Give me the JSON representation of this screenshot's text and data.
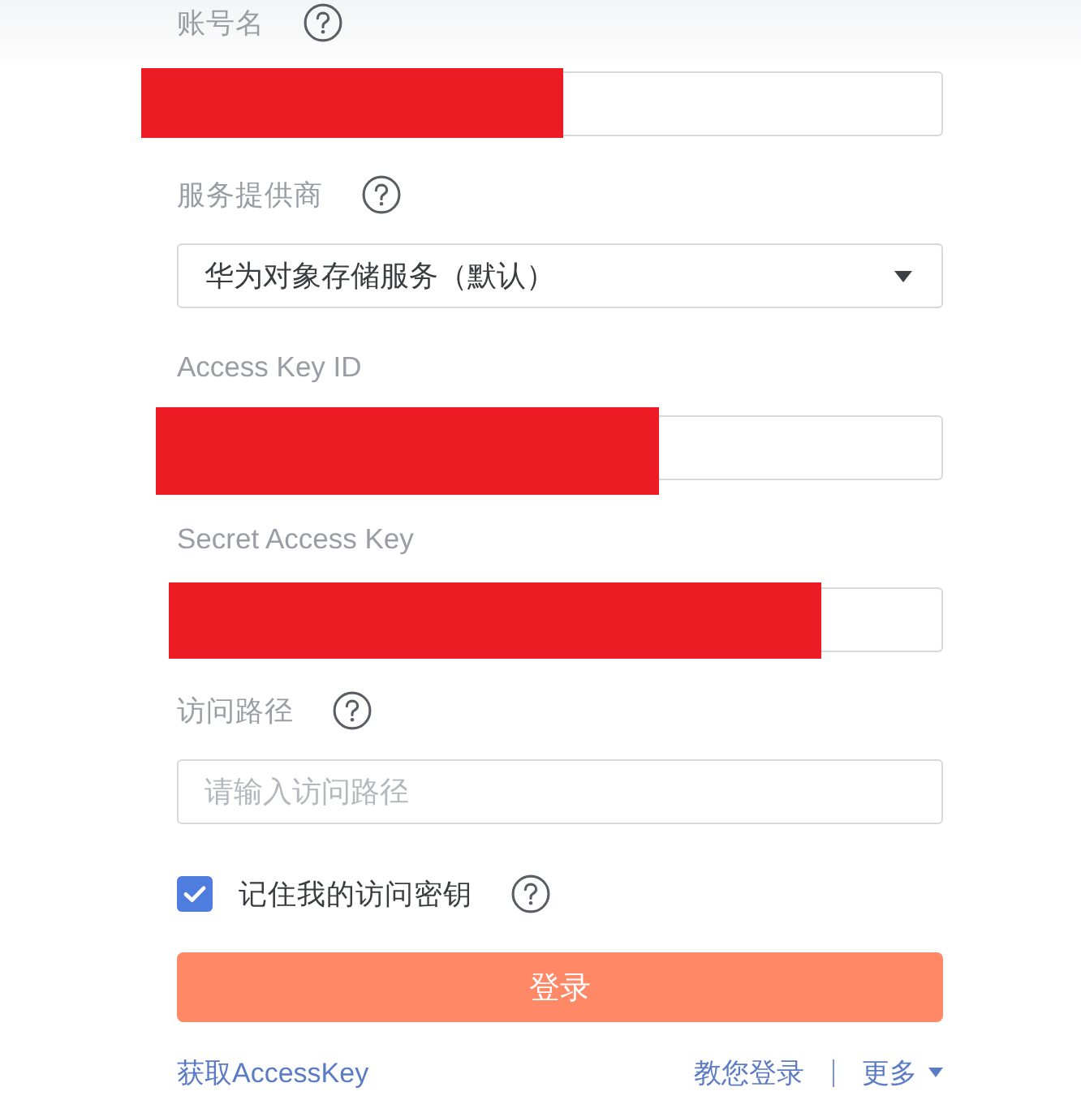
{
  "fields": [
    {
      "kind": "text",
      "label": "账号名",
      "help": true,
      "redacted": true
    },
    {
      "kind": "select",
      "label": "服务提供商",
      "help": true,
      "value": "华为对象存储服务（默认）"
    },
    {
      "kind": "text",
      "label": "Access Key ID",
      "help": false,
      "redacted": true
    },
    {
      "kind": "text",
      "label": "Secret Access Key",
      "help": false,
      "redacted": true
    },
    {
      "kind": "text",
      "label": "访问路径",
      "help": true,
      "placeholder": "请输入访问路径",
      "redacted": false
    }
  ],
  "remember": {
    "label": "记住我的访问密钥",
    "checked": true,
    "help": true
  },
  "login_button": {
    "label": "登录"
  },
  "links": {
    "left": {
      "label": "获取AccessKey"
    },
    "right": [
      {
        "label": "教您登录",
        "menu": false
      },
      {
        "label": "更多",
        "menu": true
      }
    ]
  }
}
